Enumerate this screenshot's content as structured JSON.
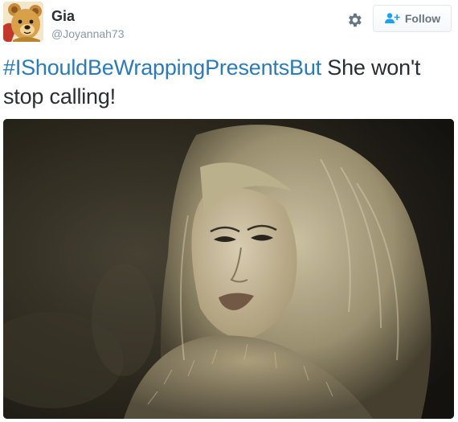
{
  "user": {
    "name": "Gia",
    "handle": "@Joyannah73"
  },
  "actions": {
    "follow_label": "Follow"
  },
  "icons": {
    "settings": "gear-icon",
    "follow": "follow-user-plus-icon"
  },
  "tweet": {
    "hashtag": "#IShouldBeWrappingPresentsBut",
    "text": " She won't stop calling!"
  },
  "colors": {
    "hashtag": "#2b7bb9",
    "name": "#292f33",
    "handle": "#8899a6",
    "follow_text": "#66757f"
  }
}
